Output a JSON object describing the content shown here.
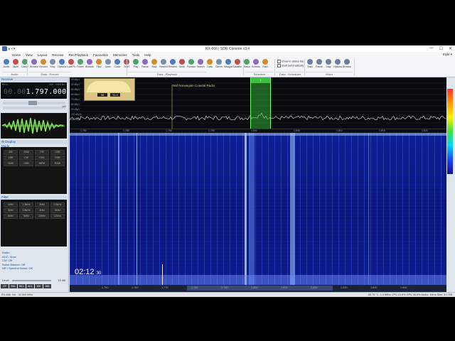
{
  "window": {
    "title": "RX-666 | SDR Console v3.4",
    "style_label": "Style"
  },
  "menu": [
    "Home",
    "View",
    "Layout",
    "Receive",
    "Rec/Playback",
    "Favourites",
    "Memories",
    "Tools",
    "Help"
  ],
  "ribbon": {
    "buttons": [
      {
        "label": "Audio",
        "name": "audio-button"
      },
      {
        "label": "Mute",
        "name": "mute-button"
      },
      {
        "label": "Cache",
        "name": "cache-button"
      },
      {
        "label": "Browse",
        "name": "browse-button"
      },
      {
        "label": "Record",
        "name": "record-button"
      },
      {
        "label": "Stop",
        "name": "stop-button"
      },
      {
        "label": "Options",
        "name": "options-button"
      },
      {
        "label": "Lock Radio",
        "name": "lock-radio-button"
      },
      {
        "label": "Folder",
        "name": "folder-button"
      },
      {
        "label": "Browse",
        "name": "browse2-button"
      },
      {
        "label": "Find",
        "name": "find-button"
      },
      {
        "label": "Open",
        "name": "open-button"
      },
      {
        "label": "Close",
        "name": "close-button"
      },
      {
        "label": "Start",
        "name": "start-button"
      },
      {
        "label": "Play",
        "name": "play-button"
      },
      {
        "label": "Pause",
        "name": "pause-button"
      },
      {
        "label": "Stop",
        "name": "stop2-button"
      },
      {
        "label": "Rewind",
        "name": "rewind-button"
      },
      {
        "label": "Rewind Back 10 seconds",
        "name": "rewind-back-button"
      },
      {
        "label": "Seek",
        "name": "seek-button"
      },
      {
        "label": "Forward 10 seconds",
        "name": "forward-button"
      },
      {
        "label": "Search",
        "name": "search-button"
      },
      {
        "label": "Data",
        "name": "data-button"
      },
      {
        "label": "Clever",
        "name": "clever-button"
      },
      {
        "label": "Navigator",
        "name": "navigator-button"
      },
      {
        "label": "Dataflle Editor",
        "name": "datafile-editor-button"
      },
      {
        "label": "Status",
        "name": "status-button"
      },
      {
        "label": "Schedule",
        "name": "schedule-button"
      },
      {
        "label": "Start",
        "name": "start2-button"
      }
    ],
    "checks": [
      "Show in status bar",
      "Start automatically"
    ],
    "video_buttons": [
      "Start",
      "Pause",
      "Stop",
      "Options",
      "Browse"
    ],
    "groups": [
      "Audio",
      "Data - Record",
      "Data - Playback",
      "Schedule",
      "Data - Scheduler",
      "Video"
    ]
  },
  "receiver": {
    "header": "Receive",
    "rx_label": "RX 1",
    "frequency_dim": "00.00",
    "frequency_main": "1.797.000",
    "range": "100 - 2000 Hz",
    "squelch_value": "100"
  },
  "display_header": "Display",
  "mode_header": "Mode",
  "modes": [
    "AM",
    "SAM",
    "FM",
    "USB",
    "LSB",
    "CW",
    "CWL",
    "DSB",
    "SAM",
    "USB",
    "WFM",
    "RAW"
  ],
  "filter_header": "Filter",
  "filters": [
    "1kHz",
    "1.5kHz",
    "2kHz",
    "2.5kHz",
    "3kHz",
    "3.5kHz",
    "4kHz",
    "5kHz",
    "6kHz",
    "8kHz",
    "10kHz",
    "12kHz"
  ],
  "properties": [
    "Radio",
    "AGC: Slow",
    "CW: Off",
    "Noise Blanker: Off",
    "NR / Spectral Noise: Off"
  ],
  "level": {
    "label": "Level",
    "value": "10 dB"
  },
  "mode_short": [
    "OF",
    "SSL",
    "WLL",
    "ACL",
    "MH",
    "MM"
  ],
  "spectrum": {
    "station_label": "NM Norwegian Coastal Radio",
    "meter_left": "58",
    "meter_right": "31.0",
    "band_marker": "1",
    "db_scale": [
      "-30 dBµV",
      "-40 dBµV",
      "-50 dBµV",
      "-60 dBµV",
      "-70 dBµV",
      "-80 dBµV",
      "-90 dBµV",
      "-100 dBµV",
      "-110 dBµV"
    ],
    "axis_ticks": [
      "1.780",
      "1.785",
      "1.790",
      "1.795",
      "1.800",
      "1.805",
      "1.810",
      "1.815",
      "1.820"
    ]
  },
  "waterfall": {
    "timestamp_main": "02:12",
    "timestamp_sub": "30"
  },
  "scroll_ticks": [
    "1.750",
    "1.760",
    "1.770",
    "1.780",
    "1.790",
    "1.800",
    "1.810",
    "1.820",
    "1.830",
    "1.840",
    "1.850"
  ],
  "status": {
    "left": "RX-666, Vol - 32.000 MHz",
    "right": "-50.76 °C, 1.0 MB/s   CPU 24.6%   GPU 36.6%   Audio: 16ms   Size: 3.0 GB"
  }
}
